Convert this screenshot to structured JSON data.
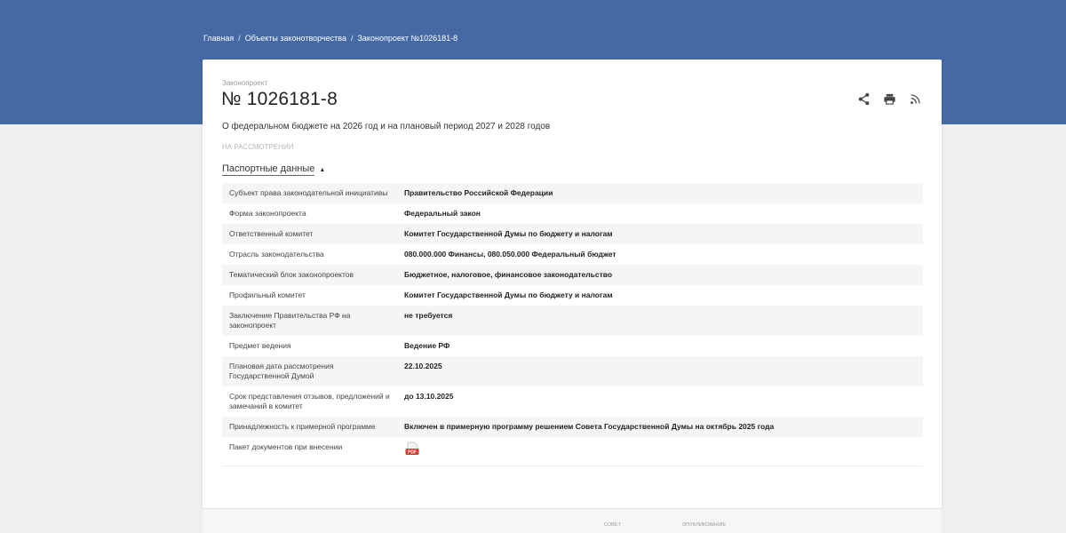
{
  "breadcrumb": [
    {
      "label": "Главная"
    },
    {
      "label": "Объекты законотворчества"
    },
    {
      "label": "Законопроект №1026181-8"
    }
  ],
  "bill": {
    "kicker": "Законопроект",
    "number": "№ 1026181-8",
    "title": "О федеральном бюджете на 2026 год и на плановый период 2027 и 2028 годов",
    "status": "НА РАССМОТРЕНИИ"
  },
  "actions": [
    {
      "icon": "share-icon"
    },
    {
      "icon": "print-icon"
    },
    {
      "icon": "rss-icon"
    }
  ],
  "passport": {
    "toggle_label": "Паспортные данные",
    "rows": [
      {
        "key": "Субъект права законодательной инициативы",
        "value": "Правительство Российской Федерации"
      },
      {
        "key": "Форма законопроекта",
        "value": "Федеральный закон"
      },
      {
        "key": "Ответственный комитет",
        "value": "Комитет Государственной Думы по бюджету и налогам"
      },
      {
        "key": "Отрасль законодательства",
        "value": "080.000.000 Финансы, 080.050.000 Федеральный бюджет"
      },
      {
        "key": "Тематический блок законопроектов",
        "value": "Бюджетное, налоговое, финансовое законодательство"
      },
      {
        "key": "Профильный комитет",
        "value": "Комитет Государственной Думы по бюджету и налогам"
      },
      {
        "key": "Заключение Правительства РФ на законопроект",
        "value": "не требуется"
      },
      {
        "key": "Предмет ведения",
        "value": "Ведение РФ"
      },
      {
        "key": "Плановая дата рассмотрения Государственной Думой",
        "value": "22.10.2025"
      },
      {
        "key": "Срок представления отзывов, предложений и замечаний в комитет",
        "value": "до 13.10.2025"
      },
      {
        "key": "Принадлежность к примерной программе",
        "value": "Включен в примерную программу решением Совета Государственной Думы на октябрь 2025 года"
      },
      {
        "key": "Пакет документов при внесении",
        "value": "",
        "icon": "pdf-icon"
      }
    ]
  },
  "footer": {
    "logo1": "СОВЕТ",
    "logo2": "ОПУБЛИКОВАНИЕ"
  },
  "colors": {
    "header": "#4469a4",
    "pdf": "#d9362b"
  }
}
